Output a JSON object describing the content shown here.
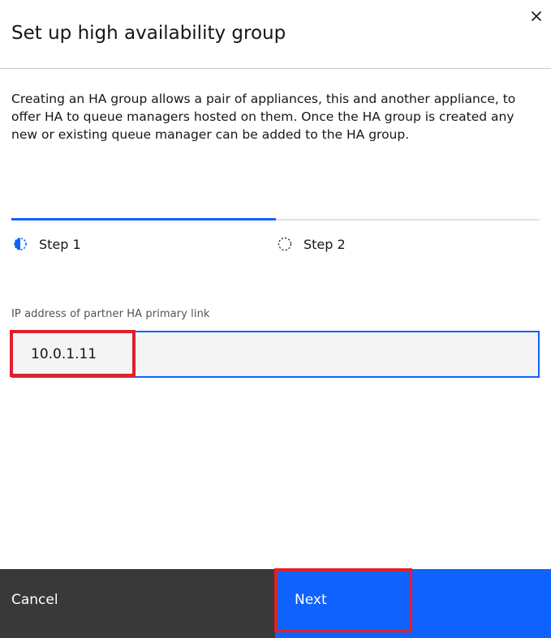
{
  "dialog": {
    "title": "Set up high availability group",
    "close_icon": "close-icon",
    "description": "Creating an HA group allows a pair of appliances, this and another appliance, to offer HA to queue managers hosted on them. Once the HA group is created any new or existing queue manager can be added to the HA group."
  },
  "progress": {
    "current_step": 1,
    "steps": [
      {
        "label": "Step 1",
        "state": "current",
        "icon": "half-filled-circle-icon"
      },
      {
        "label": "Step 2",
        "state": "incomplete",
        "icon": "dashed-circle-icon"
      }
    ]
  },
  "form": {
    "ip_label": "IP address of partner HA primary link",
    "ip_value": "10.0.1.11"
  },
  "footer": {
    "cancel_label": "Cancel",
    "next_label": "Next"
  },
  "colors": {
    "primary": "#0f62fe",
    "secondary_button": "#393939",
    "highlight": "#e0202b",
    "field_background": "#f4f4f4"
  }
}
